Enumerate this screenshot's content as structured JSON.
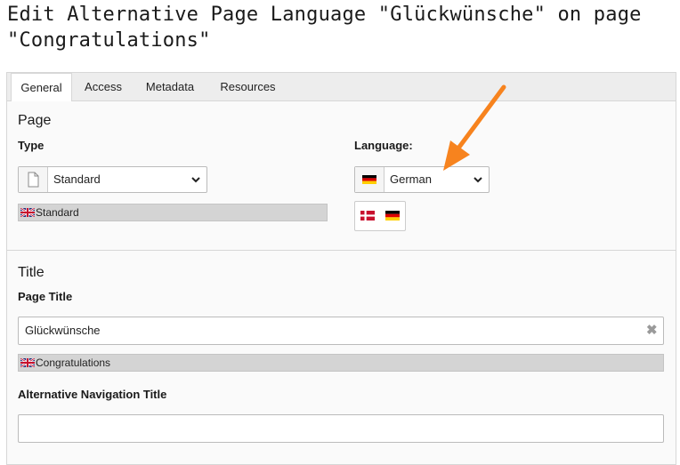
{
  "header": {
    "title": "Edit Alternative Page Language \"Glückwünsche\" on page \"Congratulations\""
  },
  "tabs": [
    {
      "label": "General",
      "active": true
    },
    {
      "label": "Access",
      "active": false
    },
    {
      "label": "Metadata",
      "active": false
    },
    {
      "label": "Resources",
      "active": false
    }
  ],
  "page_section": {
    "heading": "Page",
    "type_label": "Type",
    "type_value": "Standard",
    "type_original": "Standard",
    "language_label": "Language:",
    "language_value": "German",
    "language_flags": [
      "flag-danish-icon",
      "flag-german-icon"
    ]
  },
  "title_section": {
    "heading": "Title",
    "page_title_label": "Page Title",
    "page_title_value": "Glückwünsche",
    "page_title_original": "Congratulations",
    "nav_title_label": "Alternative Navigation Title",
    "nav_title_value": ""
  },
  "colors": {
    "accent_arrow": "#f7831e",
    "tab_bar": "#ededed",
    "original_bar": "#d4d4d4"
  }
}
